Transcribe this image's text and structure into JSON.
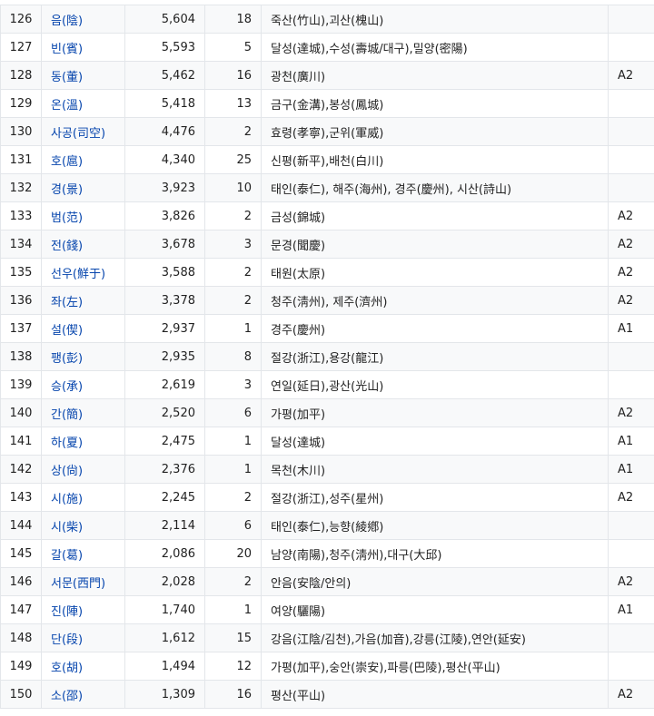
{
  "rows": [
    {
      "rank": "126",
      "surname": "음(陰)",
      "population": "5,604",
      "clans": "18",
      "origins": "죽산(竹山),괴산(槐山)",
      "grade": ""
    },
    {
      "rank": "127",
      "surname": "빈(賓)",
      "population": "5,593",
      "clans": "5",
      "origins": "달성(達城),수성(壽城/대구),밀양(密陽)",
      "grade": ""
    },
    {
      "rank": "128",
      "surname": "동(董)",
      "population": "5,462",
      "clans": "16",
      "origins": "광천(廣川)",
      "grade": "A2"
    },
    {
      "rank": "129",
      "surname": "온(溫)",
      "population": "5,418",
      "clans": "13",
      "origins": "금구(金溝),봉성(鳳城)",
      "grade": ""
    },
    {
      "rank": "130",
      "surname": "사공(司空)",
      "population": "4,476",
      "clans": "2",
      "origins": "효령(孝寧),군위(軍威)",
      "grade": ""
    },
    {
      "rank": "131",
      "surname": "호(扈)",
      "population": "4,340",
      "clans": "25",
      "origins": "신평(新平),배천(白川)",
      "grade": ""
    },
    {
      "rank": "132",
      "surname": "경(景)",
      "population": "3,923",
      "clans": "10",
      "origins": "태인(泰仁), 해주(海州), 경주(慶州), 시산(詩山)",
      "grade": ""
    },
    {
      "rank": "133",
      "surname": "범(范)",
      "population": "3,826",
      "clans": "2",
      "origins": "금성(錦城)",
      "grade": "A2"
    },
    {
      "rank": "134",
      "surname": "전(錢)",
      "population": "3,678",
      "clans": "3",
      "origins": "문경(聞慶)",
      "grade": "A2"
    },
    {
      "rank": "135",
      "surname": "선우(鮮于)",
      "population": "3,588",
      "clans": "2",
      "origins": "태원(太原)",
      "grade": "A2"
    },
    {
      "rank": "136",
      "surname": "좌(左)",
      "population": "3,378",
      "clans": "2",
      "origins": "청주(淸州), 제주(濟州)",
      "grade": "A2"
    },
    {
      "rank": "137",
      "surname": "설(偰)",
      "population": "2,937",
      "clans": "1",
      "origins": "경주(慶州)",
      "grade": "A1"
    },
    {
      "rank": "138",
      "surname": "팽(彭)",
      "population": "2,935",
      "clans": "8",
      "origins": "절강(浙江),용강(龍江)",
      "grade": ""
    },
    {
      "rank": "139",
      "surname": "승(承)",
      "population": "2,619",
      "clans": "3",
      "origins": "연일(延日),광산(光山)",
      "grade": ""
    },
    {
      "rank": "140",
      "surname": "간(簡)",
      "population": "2,520",
      "clans": "6",
      "origins": "가평(加平)",
      "grade": "A2"
    },
    {
      "rank": "141",
      "surname": "하(夏)",
      "population": "2,475",
      "clans": "1",
      "origins": "달성(達城)",
      "grade": "A1"
    },
    {
      "rank": "142",
      "surname": "상(尙)",
      "population": "2,376",
      "clans": "1",
      "origins": "목천(木川)",
      "grade": "A1"
    },
    {
      "rank": "143",
      "surname": "시(施)",
      "population": "2,245",
      "clans": "2",
      "origins": "절강(浙江),성주(星州)",
      "grade": "A2"
    },
    {
      "rank": "144",
      "surname": "시(柴)",
      "population": "2,114",
      "clans": "6",
      "origins": "태인(泰仁),능향(綾鄕)",
      "grade": ""
    },
    {
      "rank": "145",
      "surname": "갈(葛)",
      "population": "2,086",
      "clans": "20",
      "origins": "남양(南陽),청주(淸州),대구(大邱)",
      "grade": ""
    },
    {
      "rank": "146",
      "surname": "서문(西門)",
      "population": "2,028",
      "clans": "2",
      "origins": "안음(安陰/안의)",
      "grade": "A2"
    },
    {
      "rank": "147",
      "surname": "진(陣)",
      "population": "1,740",
      "clans": "1",
      "origins": "여양(驪陽)",
      "grade": "A1"
    },
    {
      "rank": "148",
      "surname": "단(段)",
      "population": "1,612",
      "clans": "15",
      "origins": "강음(江陰/김천),가음(加音),강릉(江陵),연안(延安)",
      "grade": ""
    },
    {
      "rank": "149",
      "surname": "호(胡)",
      "population": "1,494",
      "clans": "12",
      "origins": "가평(加平),숭안(崇安),파릉(巴陵),평산(平山)",
      "grade": ""
    },
    {
      "rank": "150",
      "surname": "소(邵)",
      "population": "1,309",
      "clans": "16",
      "origins": "평산(平山)",
      "grade": "A2"
    }
  ]
}
